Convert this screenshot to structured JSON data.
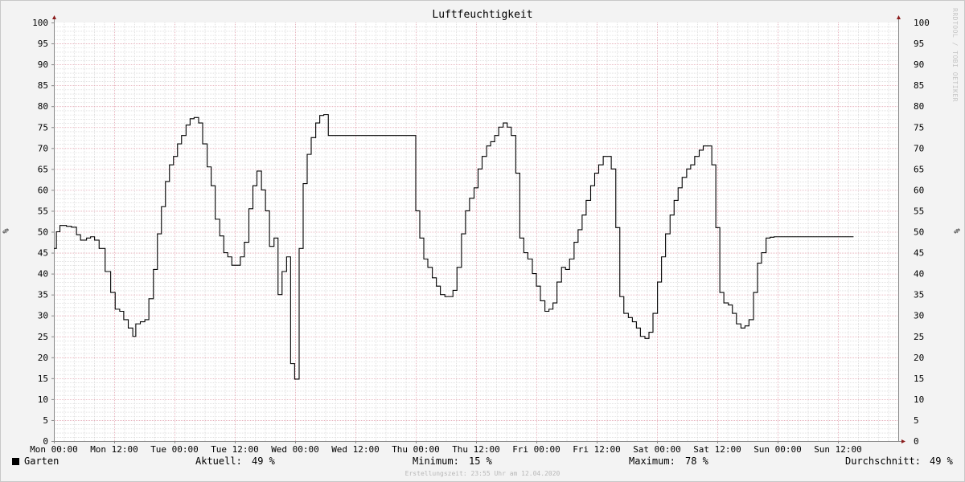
{
  "watermark": "RRDTOOL / TOBI OETIKER",
  "footer": "Erstellungszeit: 23:55 Uhr am 12.04.2020",
  "legend": {
    "name": "Garten",
    "aktuell_label": "Aktuell:",
    "aktuell_value": "49 %",
    "minimum_label": "Minimum:",
    "minimum_value": "15 %",
    "maximum_label": "Maximum:",
    "maximum_value": "78 %",
    "durchschnitt_label": "Durchschnitt:",
    "durchschnitt_value": "49 %"
  },
  "colors": {
    "series": "#000000",
    "major_grid": "#e3a6b2",
    "minor_grid": "#d0d0d0",
    "axis_arrow": "#8b1a1a"
  },
  "chart_data": {
    "type": "line",
    "title": "Luftfeuchtigkeit",
    "ylabel": "%",
    "y_axis_label_right": "%",
    "ylim": [
      0,
      100
    ],
    "xlim_hours": [
      0,
      168
    ],
    "y_ticks": [
      0,
      5,
      10,
      15,
      20,
      25,
      30,
      35,
      40,
      45,
      50,
      55,
      60,
      65,
      70,
      75,
      80,
      85,
      90,
      95,
      100
    ],
    "x_tick_hours": [
      0,
      12,
      24,
      36,
      48,
      60,
      72,
      84,
      96,
      108,
      120,
      132,
      144,
      156
    ],
    "x_tick_labels": [
      "Mon 00:00",
      "Mon 12:00",
      "Tue 00:00",
      "Tue 12:00",
      "Wed 00:00",
      "Wed 12:00",
      "Thu 00:00",
      "Thu 12:00",
      "Fri 00:00",
      "Fri 12:00",
      "Sat 00:00",
      "Sat 12:00",
      "Sun 00:00",
      "Sun 12:00"
    ],
    "grid": true,
    "step": true,
    "series": [
      {
        "name": "Garten",
        "x_hours": [
          0,
          0.5,
          1.2,
          2.5,
          3.5,
          4.5,
          5.3,
          5.8,
          6.5,
          7.3,
          8.1,
          9.0,
          10.2,
          11.3,
          12.2,
          13.1,
          13.9,
          14.8,
          15.7,
          16.3,
          17.2,
          18.1,
          18.9,
          19.8,
          20.6,
          21.4,
          22.2,
          23.0,
          23.8,
          24.6,
          25.4,
          26.3,
          27.1,
          27.9,
          28.8,
          29.6,
          30.5,
          31.3,
          32.1,
          33.0,
          33.8,
          34.6,
          35.4,
          36.3,
          37.1,
          37.9,
          38.8,
          39.6,
          40.4,
          41.3,
          42.1,
          42.9,
          43.8,
          44.6,
          45.4,
          46.3,
          47.1,
          47.9,
          48.8,
          49.6,
          50.4,
          51.2,
          52.1,
          52.9,
          53.7,
          54.6,
          72.0,
          72.8,
          73.6,
          74.4,
          75.3,
          76.1,
          76.9,
          77.8,
          78.6,
          79.4,
          80.2,
          81.1,
          81.9,
          82.7,
          83.6,
          84.4,
          85.2,
          86.1,
          86.9,
          87.7,
          88.5,
          89.4,
          90.2,
          91.0,
          91.9,
          92.7,
          93.5,
          94.3,
          95.2,
          96.0,
          96.8,
          97.7,
          98.5,
          99.3,
          100.1,
          101.0,
          101.8,
          102.6,
          103.5,
          104.3,
          105.1,
          105.9,
          106.8,
          107.6,
          108.4,
          109.3,
          110.1,
          110.9,
          111.8,
          112.6,
          113.4,
          114.3,
          115.1,
          115.9,
          116.7,
          117.6,
          118.4,
          119.2,
          120.1,
          120.9,
          121.7,
          122.6,
          123.4,
          124.2,
          125.0,
          125.9,
          126.7,
          127.5,
          128.4,
          129.2,
          130.0,
          130.9,
          131.7,
          132.5,
          133.3,
          134.2,
          135.0,
          135.8,
          136.7,
          137.5,
          138.3,
          139.2,
          140.0,
          140.8,
          141.7,
          142.5,
          143.3,
          144.1,
          145.0,
          145.8,
          146.6,
          147.5,
          148.3,
          149.1,
          150.0,
          150.8,
          151.6,
          152.5,
          153.3,
          154.1,
          155.0,
          155.8,
          156.6,
          157.4,
          158.3,
          159.1,
          159.9,
          160.8,
          161.6,
          162.4,
          163.3,
          164.1,
          165.0
        ],
        "values": [
          46,
          50,
          51.5,
          51.3,
          51.1,
          49.3,
          48,
          48,
          48.5,
          48.8,
          48,
          46,
          40.5,
          35.5,
          31.5,
          31,
          29,
          27,
          25,
          28,
          28.5,
          29,
          34,
          41,
          49.5,
          56,
          62,
          66,
          68,
          71,
          73,
          75.5,
          77,
          77.3,
          76,
          71,
          65.5,
          61,
          53,
          49,
          45,
          44,
          42,
          42,
          44,
          47.5,
          55.5,
          61,
          64.5,
          60,
          55,
          46.5,
          48.5,
          35,
          40.5,
          44,
          18.5,
          14.8,
          46,
          61.5,
          68.5,
          72.5,
          76,
          77.8,
          78,
          73,
          55,
          48.5,
          43.5,
          41.5,
          39,
          37,
          35,
          34.5,
          34.5,
          36,
          41.5,
          49.5,
          55,
          58,
          60.5,
          65,
          68,
          70.5,
          71.5,
          73,
          75,
          76,
          75,
          73,
          64,
          48.5,
          45,
          43.5,
          40,
          37,
          33.5,
          31,
          31.5,
          33,
          38,
          41.5,
          41,
          43.5,
          47.5,
          50.5,
          54,
          57.5,
          61,
          64,
          66,
          68,
          68,
          65,
          51,
          34.5,
          30.5,
          29.5,
          28.5,
          27,
          25,
          24.5,
          26,
          30.5,
          38,
          44,
          49.5,
          54,
          57.5,
          60.5,
          63,
          65,
          66,
          68,
          69.5,
          70.5,
          70.5,
          66,
          51,
          35.5,
          33,
          32.5,
          30.5,
          28,
          27,
          27.5,
          29,
          35.5,
          42.5,
          45,
          48.5,
          48.7,
          48.8,
          48.8,
          48.8,
          48.8,
          48.8,
          48.8,
          48.8,
          48.8,
          48.8,
          48.8,
          48.8,
          48.8,
          48.8,
          48.8,
          48.8,
          48.8,
          48.8,
          48.8,
          48.8,
          48.8,
          48.8,
          48.8,
          48.8,
          48.8,
          48.8,
          48.8,
          48.8,
          48.8,
          48.8
        ],
        "visible_until_hours": 158.3
      }
    ]
  }
}
